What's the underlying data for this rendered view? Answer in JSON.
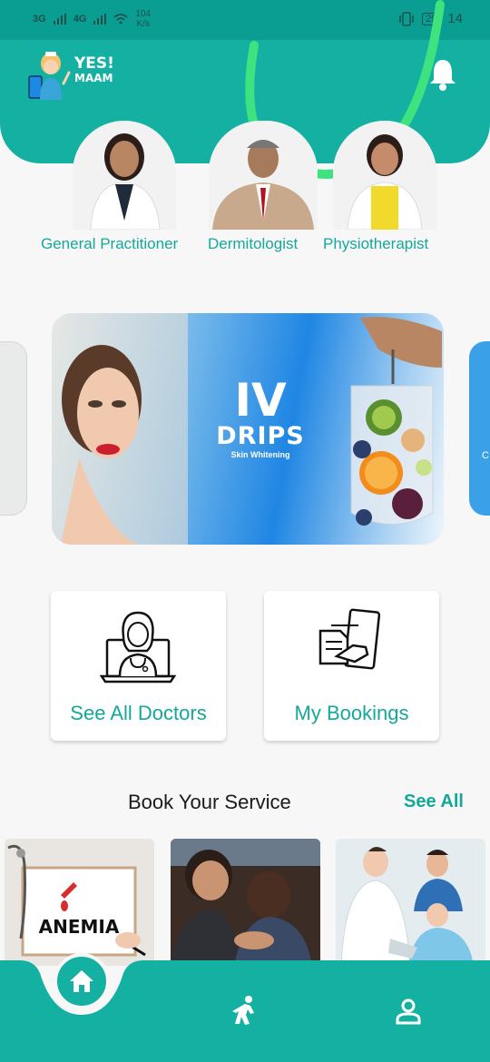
{
  "status_bar": {
    "signal1": "3G",
    "signal2": "4G",
    "net_speed_value": "104",
    "net_speed_unit": "K/s",
    "battery": "29",
    "time": "14"
  },
  "header": {
    "logo_line1": "YES!",
    "logo_line2": "MAAM",
    "bell_icon": "bell-icon"
  },
  "doctors": [
    {
      "label": "General Practitioner"
    },
    {
      "label": "Dermitologist"
    },
    {
      "label": "Physiotherapist"
    }
  ],
  "banner": {
    "title_line1": "IV",
    "title_line2": "DRIPS",
    "subtitle": "Skin Whitening"
  },
  "side_card_right_text": "C",
  "actions": [
    {
      "label": "See All Doctors",
      "icon": "doctor-laptop-icon"
    },
    {
      "label": "My Bookings",
      "icon": "bookings-icon"
    }
  ],
  "services": {
    "title": "Book Your Service",
    "see_all": "See All",
    "items": [
      {
        "caption": "ANEMIA"
      },
      {
        "caption": ""
      },
      {
        "caption": ""
      }
    ]
  },
  "nav": {
    "home_icon": "home-icon",
    "activity_icon": "person-walk-icon",
    "profile_icon": "profile-icon"
  },
  "colors": {
    "primary": "#14b1a3",
    "status_bar": "#0a9e92",
    "accent_text": "#14a89b"
  }
}
